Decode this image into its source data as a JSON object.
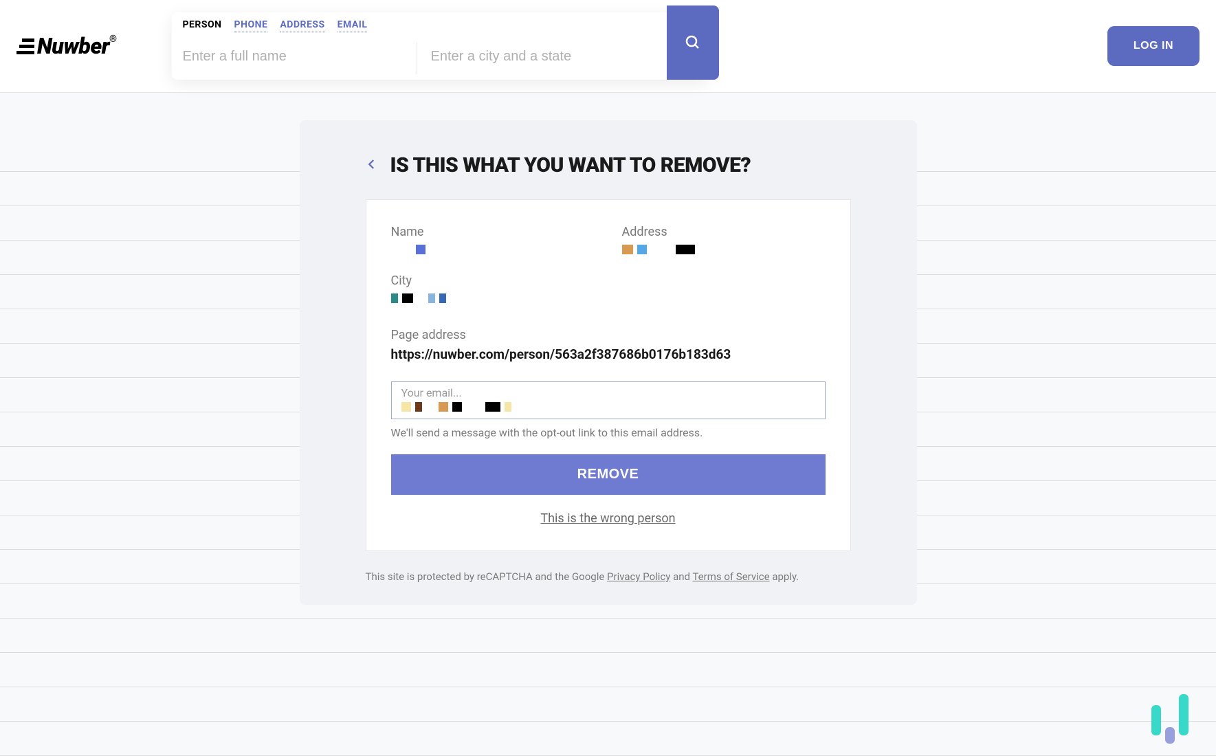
{
  "header": {
    "logo_text": "Nuwber",
    "logo_r": "®",
    "tabs": {
      "person": "PERSON",
      "phone": "PHONE",
      "address": "ADDRESS",
      "email": "EMAIL"
    },
    "name_placeholder": "Enter a full name",
    "city_placeholder": "Enter a city and a state",
    "login_label": "LOG IN"
  },
  "main": {
    "title": "IS THIS WHAT YOU WANT TO REMOVE?",
    "labels": {
      "name": "Name",
      "address": "Address",
      "city": "City",
      "page_address": "Page address"
    },
    "page_address_value": "https://nuwber.com/person/563a2f387686b0176b183d63",
    "email_placeholder": "Your email...",
    "email_hint": "We'll send a message with the opt-out link to this email address.",
    "remove_label": "REMOVE",
    "wrong_person": "This is the wrong person"
  },
  "footer": {
    "recaptcha_prefix": "This site is protected by reCAPTCHA and the Google ",
    "privacy": "Privacy Policy",
    "and": " and ",
    "terms": "Terms of Service",
    "apply": " apply."
  }
}
